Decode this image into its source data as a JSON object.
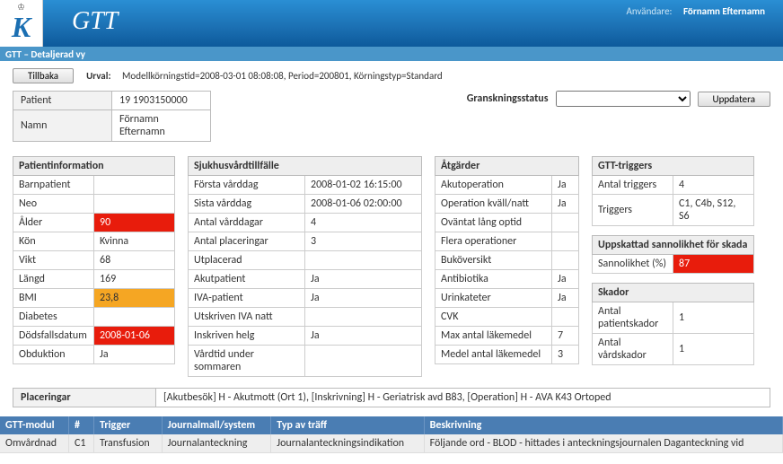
{
  "banner": {
    "app_title": "GTT",
    "user_label": "Användare:",
    "user_name": "Förnamn Efternamn",
    "logo_letter": "K"
  },
  "breadcrumb": "GTT – Detaljerad vy",
  "toolbar": {
    "back_label": "Tillbaka",
    "urval_label": "Urval:",
    "urval_text": "Modellkörningstid=2008-03-01 08:08:08, Period=200801, Körningstyp=Standard"
  },
  "patient_header": {
    "rows": [
      {
        "label": "Patient",
        "value": "19 1903150000"
      },
      {
        "label": "Namn",
        "value": "Förnamn Efternamn"
      }
    ]
  },
  "review_status": {
    "label": "Granskningsstatus",
    "selected": "",
    "update_label": "Uppdatera"
  },
  "patient_info": {
    "title": "Patientinformation",
    "rows": [
      {
        "label": "Barnpatient",
        "value": "",
        "hl": ""
      },
      {
        "label": "Neo",
        "value": "",
        "hl": ""
      },
      {
        "label": "Ålder",
        "value": "90",
        "hl": "red"
      },
      {
        "label": "Kön",
        "value": "Kvinna",
        "hl": ""
      },
      {
        "label": "Vikt",
        "value": "68",
        "hl": ""
      },
      {
        "label": "Längd",
        "value": "169",
        "hl": ""
      },
      {
        "label": "BMI",
        "value": "23,8",
        "hl": "orange"
      },
      {
        "label": "Diabetes",
        "value": "",
        "hl": ""
      },
      {
        "label": "Dödsfallsdatum",
        "value": "2008-01-06",
        "hl": "red"
      },
      {
        "label": "Obduktion",
        "value": "Ja",
        "hl": ""
      }
    ]
  },
  "hospital_stay": {
    "title": "Sjukhusvårdtillfälle",
    "rows": [
      {
        "label": "Första vårddag",
        "value": "2008-01-02 16:15:00"
      },
      {
        "label": "Sista vårddag",
        "value": "2008-01-06 02:00:00"
      },
      {
        "label": "Antal vårddagar",
        "value": "4"
      },
      {
        "label": "Antal placeringar",
        "value": "3"
      },
      {
        "label": "Utplacerad",
        "value": ""
      },
      {
        "label": "Akutpatient",
        "value": "Ja"
      },
      {
        "label": "IVA-patient",
        "value": "Ja"
      },
      {
        "label": "Utskriven IVA natt",
        "value": ""
      },
      {
        "label": "Inskriven helg",
        "value": "Ja"
      },
      {
        "label": "Vårdtid under sommaren",
        "value": ""
      }
    ]
  },
  "actions": {
    "title": "Åtgärder",
    "rows": [
      {
        "label": "Akutoperation",
        "value": "Ja"
      },
      {
        "label": "Operation kväll/natt",
        "value": "Ja"
      },
      {
        "label": "Oväntat lång optid",
        "value": ""
      },
      {
        "label": "Flera operationer",
        "value": ""
      },
      {
        "label": "Buköversikt",
        "value": ""
      },
      {
        "label": "Antibiotika",
        "value": "Ja"
      },
      {
        "label": "Urinkateter",
        "value": "Ja"
      },
      {
        "label": "CVK",
        "value": ""
      },
      {
        "label": "Max antal läkemedel",
        "value": "7"
      },
      {
        "label": "Medel antal läkemedel",
        "value": "3"
      }
    ]
  },
  "gtt_triggers": {
    "title": "GTT-triggers",
    "rows": [
      {
        "label": "Antal triggers",
        "value": "4"
      },
      {
        "label": "Triggers",
        "value": "C1, C4b, S12, S6"
      }
    ]
  },
  "probability": {
    "title": "Uppskattad sannolikhet för skada",
    "rows": [
      {
        "label": "Sannolikhet (%)",
        "value": "87",
        "hl": "red"
      }
    ]
  },
  "damages": {
    "title": "Skador",
    "rows": [
      {
        "label": "Antal patientskador",
        "value": "1"
      },
      {
        "label": "Antal vårdskador",
        "value": "1"
      }
    ]
  },
  "placements": {
    "label": "Placeringar",
    "value": "[Akutbesök] H - Akutmott (Ort 1), [Inskrivning] H - Geriatrisk avd B83, [Operation] H - AVA K43 Ortoped"
  },
  "grid": {
    "headers": [
      "GTT-modul",
      "#",
      "Trigger",
      "Journalmall/system",
      "Typ av träff",
      "Beskrivning"
    ],
    "rows": [
      [
        "Omvårdnad",
        "C1",
        "Transfusion",
        "Journalanteckning",
        "Journalanteckningsindikation",
        "Följande ord - BLOD - hittades i anteckningsjournalen Daganteckning vid"
      ]
    ]
  }
}
